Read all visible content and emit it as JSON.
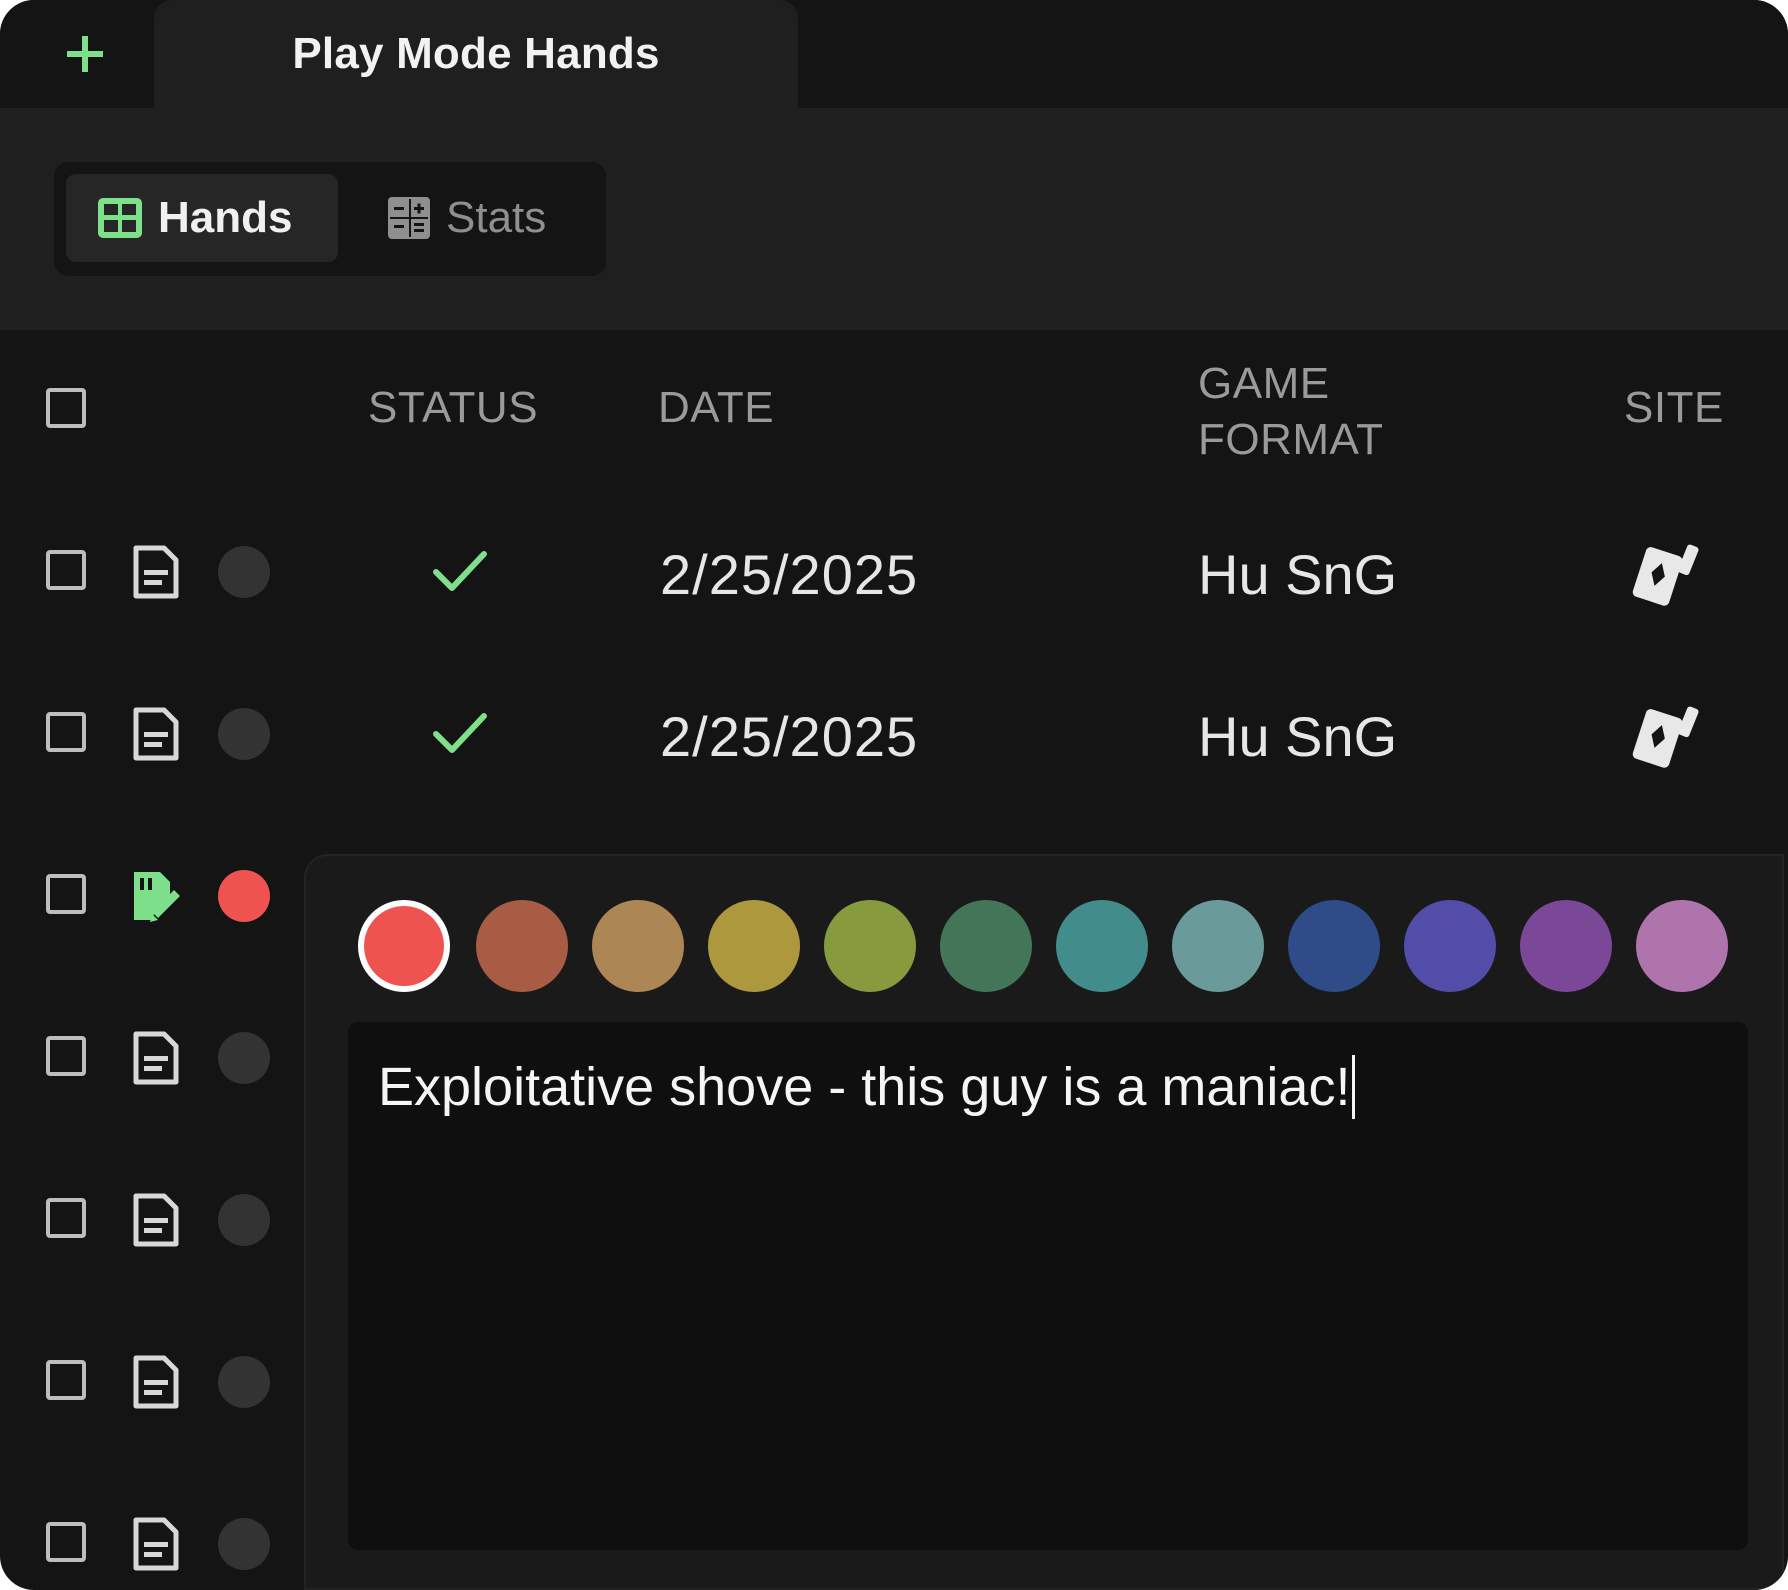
{
  "tab": {
    "title": "Play Mode Hands"
  },
  "toolbar": {
    "hands_label": "Hands",
    "stats_label": "Stats"
  },
  "table": {
    "columns": [
      "STATUS",
      "DATE",
      "GAME FORMAT",
      "SITE"
    ],
    "column_game_format_line1": "GAME",
    "column_game_format_line2": "FORMAT",
    "rows": [
      {
        "status": "done",
        "date": "2/25/2025",
        "game_format": "Hu SnG",
        "site_icon": "cards-icon",
        "note_icon": "document-icon",
        "color": "none"
      },
      {
        "status": "done",
        "date": "2/25/2025",
        "game_format": "Hu SnG",
        "site_icon": "cards-icon",
        "note_icon": "document-icon",
        "color": "none"
      },
      {
        "status": "",
        "date": "",
        "game_format": "",
        "note_icon": "document-edit-icon",
        "color": "#ef5350"
      },
      {
        "status": "",
        "date": "",
        "game_format": "",
        "note_icon": "document-icon",
        "color": "none"
      },
      {
        "status": "",
        "date": "",
        "game_format": "",
        "note_icon": "document-icon",
        "color": "none"
      },
      {
        "status": "",
        "date": "",
        "game_format": "",
        "note_icon": "document-icon",
        "color": "none"
      },
      {
        "status": "",
        "date": "",
        "game_format": "",
        "note_icon": "document-icon",
        "color": "none"
      }
    ]
  },
  "note_popover": {
    "swatches": [
      "#ef5350",
      "#a95c44",
      "#ad8655",
      "#ad983e",
      "#879a3e",
      "#437658",
      "#428c8c",
      "#6b9a9a",
      "#2f4b88",
      "#534daa",
      "#7a4896",
      "#b074ac"
    ],
    "selected_swatch": "#ef5350",
    "text": "Exploitative shove - this guy is a maniac!"
  },
  "colors": {
    "accent_green": "#7ee08a",
    "background": "#141414",
    "panel": "#1f1f1f"
  }
}
